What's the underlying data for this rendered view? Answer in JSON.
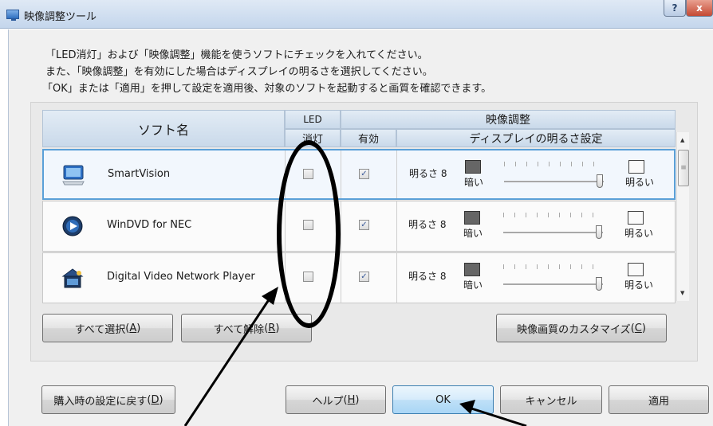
{
  "window": {
    "title": "映像調整ツール",
    "help_label": "?",
    "close_label": "x"
  },
  "instructions": [
    "「LED消灯」および「映像調整」機能を使うソフトにチェックを入れてください。",
    "また、「映像調整」を有効にした場合はディスプレイの明るさを選択してください。",
    "「OK」または「適用」を押して設定を適用後、対象のソフトを起動すると画質を確認できます。"
  ],
  "table": {
    "col_software": "ソフト名",
    "col_led_top": "LED",
    "col_led_bottom": "消灯",
    "col_video": "映像調整",
    "col_enabled": "有効",
    "col_brightness": "ディスプレイの明るさ設定",
    "rows": [
      {
        "name": "SmartVision",
        "icon": "tv-monitor-icon",
        "led_off": false,
        "enabled": true,
        "brightness_label": "明るさ 8",
        "brightness_value": 8,
        "dark_label": "暗い",
        "light_label": "明るい"
      },
      {
        "name": "WinDVD for NEC",
        "icon": "dvd-play-icon",
        "led_off": false,
        "enabled": true,
        "brightness_label": "明るさ 8",
        "brightness_value": 8,
        "dark_label": "暗い",
        "light_label": "明るい"
      },
      {
        "name": "Digital Video Network Player",
        "icon": "network-player-icon",
        "led_off": false,
        "enabled": true,
        "brightness_label": "明るさ 8",
        "brightness_value": 8,
        "dark_label": "暗い",
        "light_label": "明るい"
      }
    ],
    "scroll_grip": "≡"
  },
  "buttons": {
    "select_all": "すべて選択",
    "select_all_key": "A",
    "clear_all": "すべて解除",
    "clear_all_key": "R",
    "customize": "映像画質のカスタマイズ",
    "customize_key": "C",
    "restore": "購入時の設定に戻す",
    "restore_key": "D",
    "help": "ヘルプ",
    "help_key": "H",
    "ok": "OK",
    "cancel": "キャンセル",
    "apply": "適用"
  },
  "colors": {
    "selection_border": "#5aa0d8",
    "header_bg": "#d3e1ef",
    "annotation": "#000000"
  }
}
